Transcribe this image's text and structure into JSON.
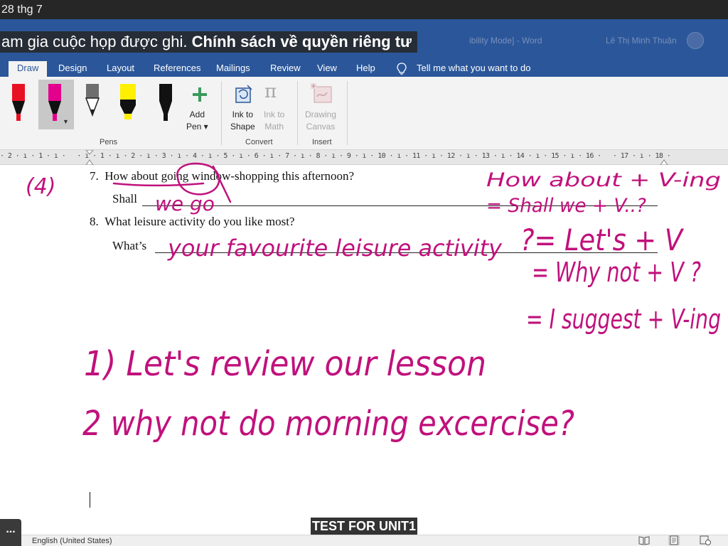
{
  "status": {
    "date": "28 thg 7"
  },
  "window": {
    "title_faint": "ibility Mode] - Word",
    "user_name": "Lê Thị Minh Thuận",
    "caption_text": "am gia cuộc họp được ghi. ",
    "caption_bold": "Chính sách về quyền riêng tư"
  },
  "tabs": [
    {
      "label": "Draw",
      "active": true
    },
    {
      "label": "Design"
    },
    {
      "label": "Layout"
    },
    {
      "label": "References"
    },
    {
      "label": "Mailings"
    },
    {
      "label": "Review"
    },
    {
      "label": "View"
    },
    {
      "label": "Help"
    }
  ],
  "tellme": "Tell me what you want to do",
  "ribbon": {
    "add_pen": [
      "Add",
      "Pen ▾"
    ],
    "ink_to_shape": [
      "Ink to",
      "Shape"
    ],
    "ink_to_math": [
      "Ink to",
      "Math"
    ],
    "drawing_canvas": [
      "Drawing",
      "Canvas"
    ],
    "groups": {
      "pens": "Pens",
      "convert": "Convert",
      "insert": "Insert"
    },
    "pen_colors": [
      "#e81123",
      "#e3008c",
      "#5a5a5a",
      "#ffef00",
      "#111111"
    ]
  },
  "ruler": "· 2 · ı · 1 · ı ·   · ı · 1 · ı · 2 · ı · 3 · ı · 4 · ı · 5 · ı · 6 · ı · 7 · ı · 8 · ı · 9 · ı · 10 · ı · 11 · ı · 12 · ı · 13 · ı · 14 · ı · 15 · ı · 16 ·   · 17 · ı · 18 ·",
  "document": {
    "q7": {
      "num": "7.",
      "text": "How about going window-shopping this afternoon?",
      "answer_prefix": "Shall"
    },
    "q8": {
      "num": "8.",
      "text": "What leisure activity do you like most?",
      "answer_prefix": "What’s"
    }
  },
  "handwriting": {
    "label_4": "(4)",
    "we_go": "we go",
    "how_about": "How about + V-ing",
    "shall_we": "= Shall we + V..?",
    "favourite": "your favourite leisure activity",
    "lets": "?= Let's + V",
    "why_not": "= Why not + V ?",
    "suggest": "= I suggest + V-ing",
    "line1": "1) Let's review our lesson",
    "line2": "2  why not do morning excercise?"
  },
  "ink_color": "#c0117c",
  "test_caption": "TEST FOR UNIT1",
  "statusbar": {
    "language": "English (United States)",
    "more": "..."
  }
}
